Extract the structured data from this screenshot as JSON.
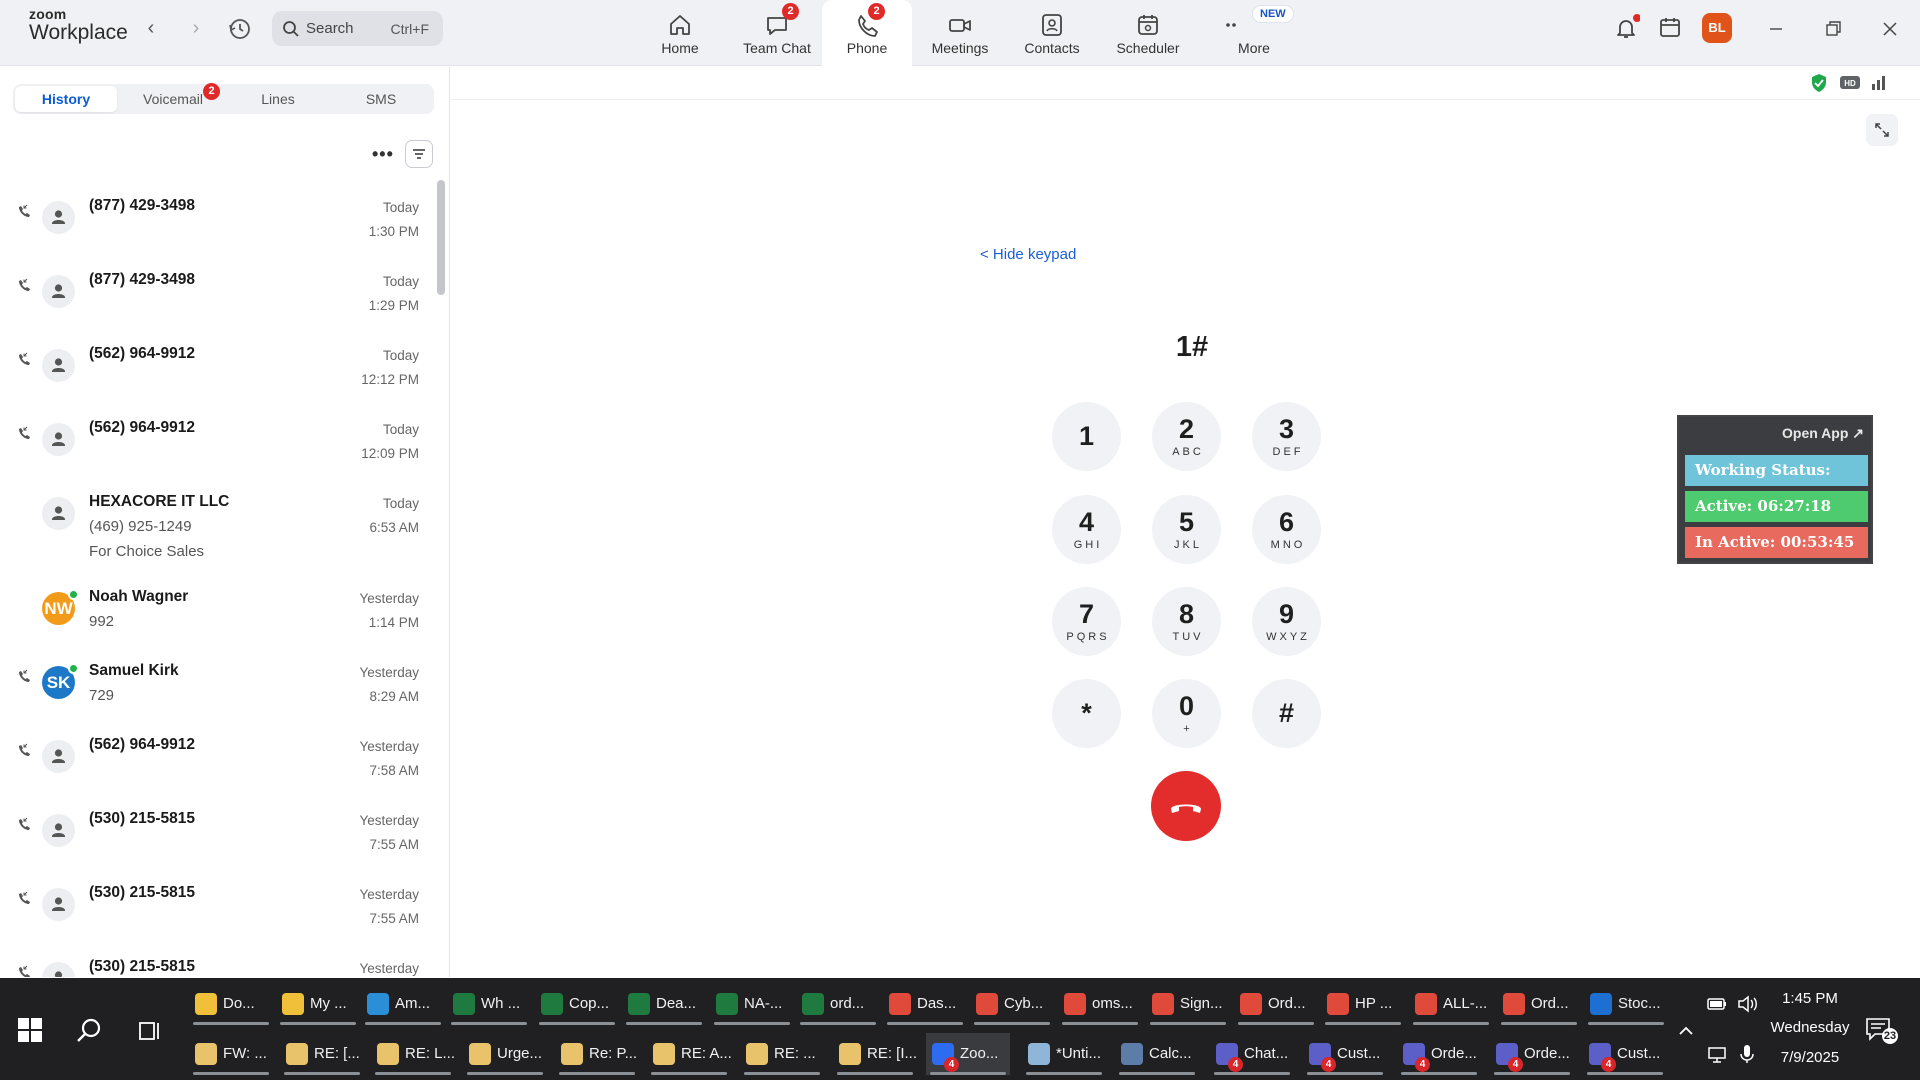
{
  "app": {
    "logo_line1": "zoom",
    "logo_line2": "Workplace",
    "search_placeholder": "Search",
    "search_shortcut": "Ctrl+F",
    "user_initials": "BL",
    "accent_color": "#0b5cd5"
  },
  "nav_tabs": [
    {
      "label": "Home",
      "icon": "home-icon",
      "badge": ""
    },
    {
      "label": "Team Chat",
      "icon": "chat-icon",
      "badge": "2"
    },
    {
      "label": "Phone",
      "icon": "phone-icon",
      "badge": "2",
      "active": true
    },
    {
      "label": "Meetings",
      "icon": "video-icon",
      "badge": ""
    },
    {
      "label": "Contacts",
      "icon": "contacts-icon",
      "badge": ""
    },
    {
      "label": "Scheduler",
      "icon": "calendar-icon",
      "badge": ""
    },
    {
      "label": "More",
      "icon": "more-icon",
      "badge": "NEW"
    }
  ],
  "phone_tabs": [
    {
      "label": "History",
      "active": true,
      "badge": ""
    },
    {
      "label": "Voicemail",
      "active": false,
      "badge": "2"
    },
    {
      "label": "Lines",
      "active": false,
      "badge": ""
    },
    {
      "label": "SMS",
      "active": false,
      "badge": ""
    }
  ],
  "calls": [
    {
      "name": "(877) 429-3498",
      "sub1": "",
      "sub2": "",
      "day": "Today",
      "time": "1:30 PM",
      "avatar": "person",
      "direction": true
    },
    {
      "name": "(877) 429-3498",
      "sub1": "",
      "sub2": "",
      "day": "Today",
      "time": "1:29 PM",
      "avatar": "person",
      "direction": true
    },
    {
      "name": "(562) 964-9912",
      "sub1": "",
      "sub2": "",
      "day": "Today",
      "time": "12:12 PM",
      "avatar": "person",
      "direction": true
    },
    {
      "name": "(562) 964-9912",
      "sub1": "",
      "sub2": "",
      "day": "Today",
      "time": "12:09 PM",
      "avatar": "person",
      "direction": true
    },
    {
      "name": "HEXACORE IT LLC",
      "sub1": "(469) 925-1249",
      "sub2": "For Choice Sales",
      "day": "Today",
      "time": "6:53 AM",
      "avatar": "person",
      "direction": false
    },
    {
      "name": "Noah Wagner",
      "sub1": "992",
      "sub2": "",
      "day": "Yesterday",
      "time": "1:14 PM",
      "avatar": "NW",
      "avatar_color": "#f29a1a",
      "online": true,
      "direction": false
    },
    {
      "name": "Samuel Kirk",
      "sub1": "729",
      "sub2": "",
      "day": "Yesterday",
      "time": "8:29 AM",
      "avatar": "SK",
      "avatar_color": "#1e78c8",
      "online": true,
      "direction": true
    },
    {
      "name": "(562) 964-9912",
      "sub1": "",
      "sub2": "",
      "day": "Yesterday",
      "time": "7:58 AM",
      "avatar": "person",
      "direction": true
    },
    {
      "name": "(530) 215-5815",
      "sub1": "",
      "sub2": "",
      "day": "Yesterday",
      "time": "7:55 AM",
      "avatar": "person",
      "direction": true
    },
    {
      "name": "(530) 215-5815",
      "sub1": "",
      "sub2": "",
      "day": "Yesterday",
      "time": "7:55 AM",
      "avatar": "person",
      "direction": true
    },
    {
      "name": "(530) 215-5815",
      "sub1": "",
      "sub2": "",
      "day": "Yesterday",
      "time": "",
      "avatar": "person",
      "direction": true
    }
  ],
  "dialer": {
    "hide_keypad": "< Hide keypad",
    "dialed_number": "1#",
    "keys": [
      {
        "digit": "1",
        "letters": ""
      },
      {
        "digit": "2",
        "letters": "ABC"
      },
      {
        "digit": "3",
        "letters": "DEF"
      },
      {
        "digit": "4",
        "letters": "GHI"
      },
      {
        "digit": "5",
        "letters": "JKL"
      },
      {
        "digit": "6",
        "letters": "MNO"
      },
      {
        "digit": "7",
        "letters": "PQRS"
      },
      {
        "digit": "8",
        "letters": "TUV"
      },
      {
        "digit": "9",
        "letters": "WXYZ"
      },
      {
        "digit": "*",
        "letters": ""
      },
      {
        "digit": "0",
        "letters": "+"
      },
      {
        "digit": "#",
        "letters": ""
      }
    ],
    "hangup_color": "#e32c2c"
  },
  "status_widget": {
    "open_app": "Open App ↗",
    "working_status": "Working Status: Active",
    "active_time": "Active: 06:27:18",
    "inactive_time": "In Active: 00:53:45",
    "colors": {
      "status": "#6fc4d9",
      "active": "#4ecb6e",
      "inactive": "#e86a5e"
    }
  },
  "taskbar": {
    "row1": [
      {
        "label": "Do...",
        "icon": "file-explorer-icon",
        "color": "#f0c03a"
      },
      {
        "label": "My ...",
        "icon": "folder-icon",
        "color": "#f0c03a"
      },
      {
        "label": "Am...",
        "icon": "edge-icon",
        "color": "#2a8fd6"
      },
      {
        "label": "Wh ...",
        "icon": "excel-icon",
        "color": "#1f7a3f"
      },
      {
        "label": "Cop...",
        "icon": "excel-icon",
        "color": "#1f7a3f"
      },
      {
        "label": "Dea...",
        "icon": "excel-icon",
        "color": "#1f7a3f"
      },
      {
        "label": "NA-...",
        "icon": "excel-icon",
        "color": "#1f7a3f"
      },
      {
        "label": "ord...",
        "icon": "excel-icon",
        "color": "#1f7a3f"
      },
      {
        "label": "Das...",
        "icon": "chrome-icon",
        "color": "#e04a3a"
      },
      {
        "label": "Cyb...",
        "icon": "chrome-icon",
        "color": "#e04a3a"
      },
      {
        "label": "oms...",
        "icon": "chrome-icon",
        "color": "#e04a3a"
      },
      {
        "label": "Sign...",
        "icon": "chrome-icon",
        "color": "#e04a3a"
      },
      {
        "label": "Ord...",
        "icon": "chrome-icon",
        "color": "#e04a3a"
      },
      {
        "label": "HP ...",
        "icon": "chrome-icon",
        "color": "#e04a3a"
      },
      {
        "label": "ALL-...",
        "icon": "chrome-icon",
        "color": "#e04a3a"
      },
      {
        "label": "Ord...",
        "icon": "chrome-icon",
        "color": "#e04a3a"
      },
      {
        "label": "Stoc...",
        "icon": "outlook-icon",
        "color": "#1d6fd1"
      }
    ],
    "row2": [
      {
        "label": "FW: ...",
        "icon": "mail-icon",
        "color": "#e8c36b",
        "badge": ""
      },
      {
        "label": "RE: [...",
        "icon": "mail-icon",
        "color": "#e8c36b",
        "badge": ""
      },
      {
        "label": "RE: L...",
        "icon": "mail-icon",
        "color": "#e8c36b",
        "badge": ""
      },
      {
        "label": "Urge...",
        "icon": "mail-icon",
        "color": "#e8c36b",
        "badge": ""
      },
      {
        "label": "Re: P...",
        "icon": "mail-icon",
        "color": "#e8c36b",
        "badge": ""
      },
      {
        "label": "RE: A...",
        "icon": "mail-icon",
        "color": "#e8c36b",
        "badge": ""
      },
      {
        "label": "RE: ...",
        "icon": "mail-icon",
        "color": "#e8c36b",
        "badge": ""
      },
      {
        "label": "RE: [I...",
        "icon": "mail-icon",
        "color": "#e8c36b",
        "badge": ""
      },
      {
        "label": "Zoo...",
        "icon": "zoom-icon",
        "color": "#2d6cf0",
        "badge": "4",
        "active": true
      },
      {
        "label": "*Unti...",
        "icon": "notepad-icon",
        "color": "#8fb6d9",
        "badge": ""
      },
      {
        "label": "Calc...",
        "icon": "calculator-icon",
        "color": "#5c7da8",
        "badge": ""
      },
      {
        "label": "Chat...",
        "icon": "teams-icon",
        "color": "#5b5fc7",
        "badge": "4"
      },
      {
        "label": "Cust...",
        "icon": "teams-icon",
        "color": "#5b5fc7",
        "badge": "4"
      },
      {
        "label": "Orde...",
        "icon": "teams-icon",
        "color": "#5b5fc7",
        "badge": "4"
      },
      {
        "label": "Orde...",
        "icon": "teams-icon",
        "color": "#5b5fc7",
        "badge": "4"
      },
      {
        "label": "Cust...",
        "icon": "teams-icon",
        "color": "#5b5fc7",
        "badge": "4"
      }
    ],
    "clock_time": "1:45 PM",
    "clock_day": "Wednesday",
    "clock_date": "7/9/2025",
    "notification_count": "23"
  }
}
